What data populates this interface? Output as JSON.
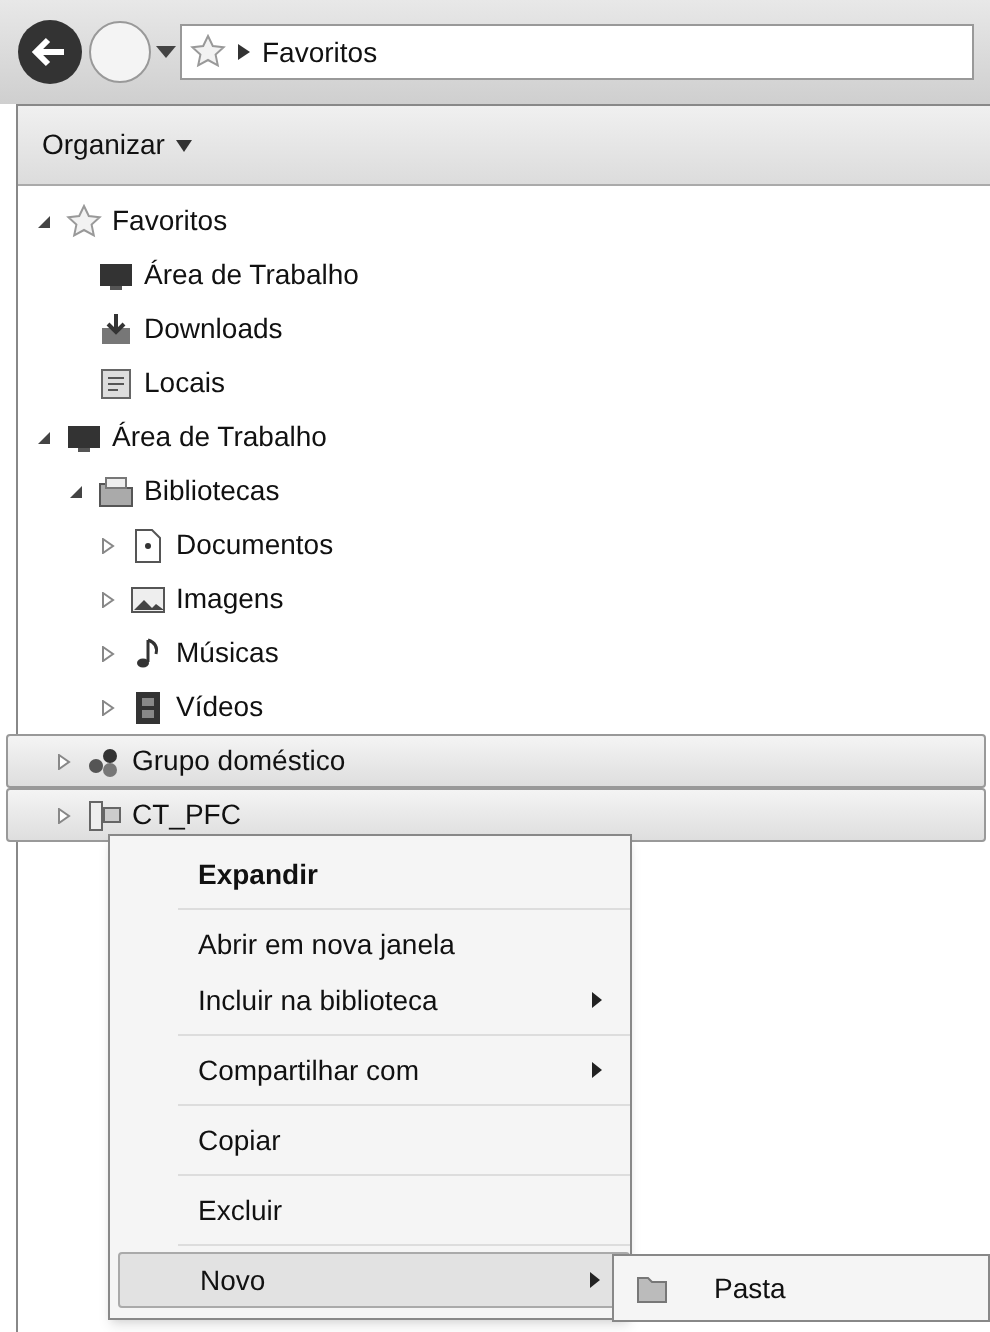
{
  "address_bar": {
    "location": "Favoritos"
  },
  "toolbar": {
    "organize_label": "Organizar"
  },
  "tree": [
    {
      "label": "Favoritos",
      "kind": "star",
      "expanded": true,
      "selected": false,
      "children": [
        {
          "label": "Área de Trabalho",
          "kind": "desktop",
          "selected": false
        },
        {
          "label": "Downloads",
          "kind": "download",
          "selected": false
        },
        {
          "label": "Locais",
          "kind": "places",
          "selected": false
        }
      ]
    },
    {
      "label": "Área de Trabalho",
      "kind": "desktop",
      "expanded": true,
      "selected": false,
      "children": [
        {
          "label": "Bibliotecas",
          "kind": "library",
          "expanded": true,
          "selected": false,
          "children": [
            {
              "label": "Documentos",
              "kind": "document",
              "expanded": false,
              "selected": false
            },
            {
              "label": "Imagens",
              "kind": "image",
              "expanded": false,
              "selected": false
            },
            {
              "label": "Músicas",
              "kind": "music",
              "expanded": false,
              "selected": false
            },
            {
              "label": "Vídeos",
              "kind": "video",
              "expanded": false,
              "selected": false
            }
          ]
        },
        {
          "label": "Grupo doméstico",
          "kind": "homegroup",
          "expanded": false,
          "selected": true
        },
        {
          "label": "CT_PFC",
          "kind": "computer",
          "expanded": false,
          "selected": true
        }
      ]
    }
  ],
  "context_menu": {
    "groups": [
      [
        {
          "label": "Expandir",
          "bold": true,
          "has_submenu": false,
          "selected": false
        }
      ],
      [
        {
          "label": "Abrir em nova janela",
          "bold": false,
          "has_submenu": false,
          "selected": false
        },
        {
          "label": "Incluir na biblioteca",
          "bold": false,
          "has_submenu": true,
          "selected": false
        }
      ],
      [
        {
          "label": "Compartilhar com",
          "bold": false,
          "has_submenu": true,
          "selected": false
        }
      ],
      [
        {
          "label": "Copiar",
          "bold": false,
          "has_submenu": false,
          "selected": false
        }
      ],
      [
        {
          "label": "Excluir",
          "bold": false,
          "has_submenu": false,
          "selected": false
        }
      ],
      [
        {
          "label": "Novo",
          "bold": false,
          "has_submenu": true,
          "selected": true
        }
      ]
    ]
  },
  "submenu": {
    "items": [
      {
        "label": "Pasta",
        "kind": "folder"
      }
    ]
  }
}
